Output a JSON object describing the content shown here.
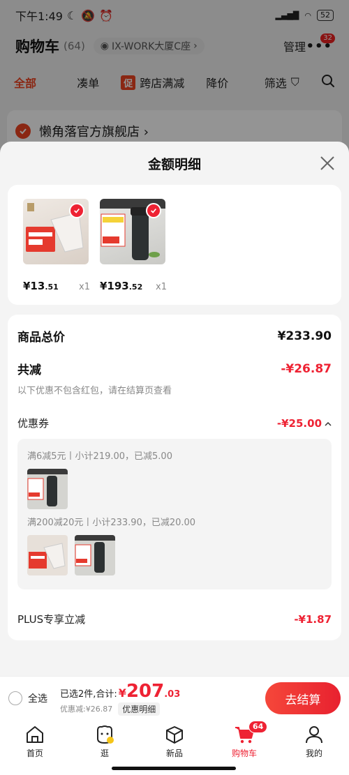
{
  "status_bar": {
    "time": "下午1:49",
    "battery": "52"
  },
  "header": {
    "title": "购物车",
    "count": "(64)",
    "address": "IX-WORK大厦C座",
    "manage": "管理",
    "more_badge": "32"
  },
  "filter_tabs": [
    "全部",
    "凑单",
    "跨店满减",
    "降价",
    "筛选"
  ],
  "filter_promo_tag": "促",
  "store": {
    "name": "懒角落官方旗舰店 ›"
  },
  "sheet": {
    "title": "金额明细",
    "products": [
      {
        "price_yen": "¥13",
        "price_dec": ".51",
        "qty": "x1"
      },
      {
        "price_yen": "¥193",
        "price_dec": ".52",
        "qty": "x1"
      }
    ],
    "total_label": "商品总价",
    "total_value": "¥233.90",
    "discount_label": "共减",
    "discount_value": "-¥26.87",
    "discount_note": "以下优惠不包含红包，请在结算页查看",
    "coupon_label": "优惠券",
    "coupon_value": "-¥25.00",
    "coupon_rule_1": "满6减5元丨小计219.00，已减5.00",
    "coupon_rule_2": "满200减20元丨小计233.90，已减20.00",
    "plus_label": "PLUS专享立减",
    "plus_value": "-¥1.87"
  },
  "checkout": {
    "select_all": "全选",
    "selected_text": "已选2件,合计:",
    "yen": "¥",
    "amount_int": "207",
    "amount_dec": ".03",
    "discount_text": "优惠减:¥26.87",
    "detail_pill": "优惠明细",
    "pay_button": "去结算"
  },
  "bottom_nav": [
    {
      "label": "首页",
      "icon": "home-icon"
    },
    {
      "label": "逛",
      "icon": "mascot-icon"
    },
    {
      "label": "新品",
      "icon": "box-icon"
    },
    {
      "label": "购物车",
      "icon": "cart-icon",
      "badge": "64"
    },
    {
      "label": "我的",
      "icon": "person-icon"
    }
  ],
  "colors": {
    "accent": "#e42233",
    "sheet_bg": "#f4f4f4"
  }
}
